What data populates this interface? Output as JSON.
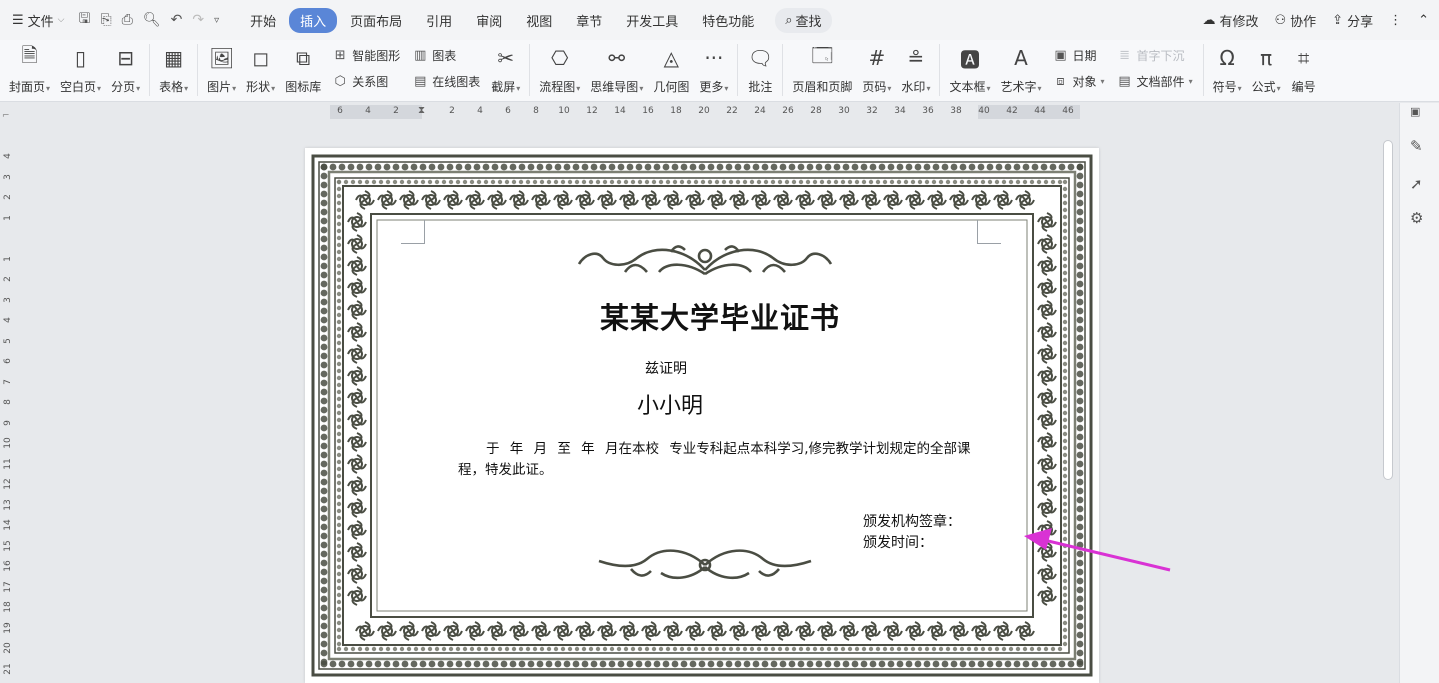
{
  "menubar": {
    "file_label": "文件",
    "tabs": [
      "开始",
      "插入",
      "页面布局",
      "引用",
      "审阅",
      "视图",
      "章节",
      "开发工具",
      "特色功能"
    ],
    "active_tab": "插入",
    "search_label": "查找",
    "right": {
      "changes": "有修改",
      "collab": "协作",
      "share": "分享"
    }
  },
  "ribbon": {
    "cover": "封面页",
    "blank": "空白页",
    "pagebreak": "分页",
    "table": "表格",
    "picture": "图片",
    "shape": "形状",
    "iconlib": "图标库",
    "smartart": "智能图形",
    "relation": "关系图",
    "chart": "图表",
    "onlinechart": "在线图表",
    "screenshot": "截屏",
    "flowchart": "流程图",
    "mindmap": "思维导图",
    "geometry": "几何图",
    "more": "更多",
    "comment": "批注",
    "headerfooter": "页眉和页脚",
    "pagenum": "页码",
    "watermark": "水印",
    "textbox": "文本框",
    "wordart": "艺术字",
    "date": "日期",
    "object": "对象",
    "dropcap": "首字下沉",
    "docparts": "文档部件",
    "symbol": "符号",
    "formula": "公式",
    "numbering": "编号"
  },
  "ruler": {
    "h_ticks": [
      "6",
      "4",
      "2",
      "",
      "2",
      "4",
      "6",
      "8",
      "10",
      "12",
      "14",
      "16",
      "18",
      "20",
      "22",
      "24",
      "26",
      "28",
      "30",
      "32",
      "34",
      "36",
      "38",
      "40",
      "42",
      "44",
      "46"
    ],
    "v_ticks": [
      "4",
      "3",
      "2",
      "1",
      "",
      "1",
      "2",
      "3",
      "4",
      "5",
      "6",
      "7",
      "8",
      "9",
      "10",
      "11",
      "12",
      "13",
      "14",
      "15",
      "16",
      "17",
      "18",
      "19",
      "20",
      "21"
    ]
  },
  "certificate": {
    "title": "某某大学毕业证书",
    "prove": "兹证明",
    "name": "小小明",
    "body": "于 年 月 至 年 月在本校 专业专科起点本科学习,修完教学计划规定的全部课程，特发此证。",
    "issuer": "颁发机构签章：",
    "date": "颁发时间："
  },
  "colors": {
    "accent": "#5a86d7",
    "border_dark": "#4a4d43",
    "border_mid": "#7d8074",
    "arrow": "#d932d4"
  }
}
